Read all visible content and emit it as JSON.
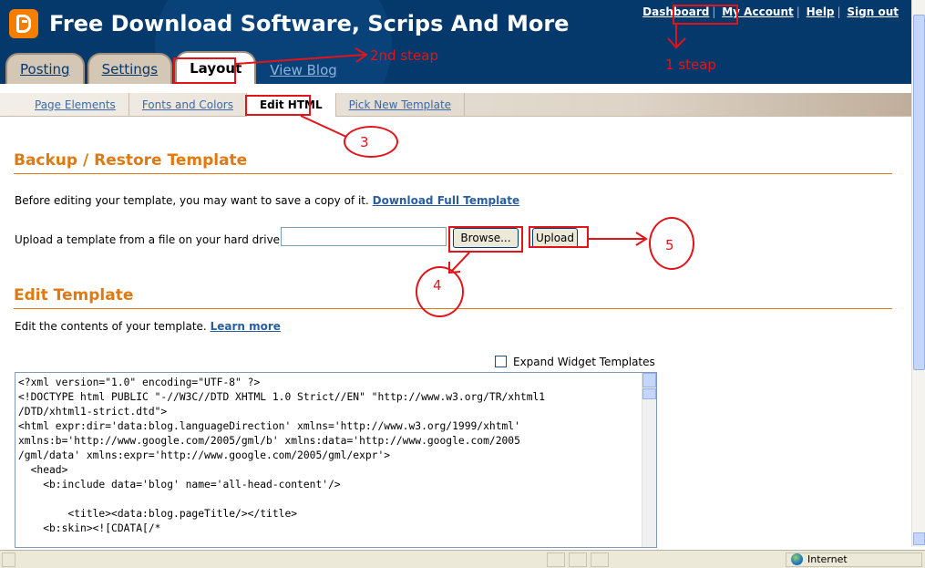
{
  "header": {
    "blog_title": "Free Download Software, Scrips And More",
    "account_links": [
      "Dashboard",
      "My Account",
      "Help",
      "Sign out"
    ]
  },
  "tabs": {
    "posting": "Posting",
    "settings": "Settings",
    "layout": "Layout",
    "view_blog": "View Blog"
  },
  "subnav": {
    "page_elements": "Page Elements",
    "fonts_colors": "Fonts and Colors",
    "edit_html": "Edit HTML",
    "pick_template": "Pick New Template"
  },
  "backup": {
    "title": "Backup / Restore Template",
    "intro": "Before editing your template, you may want to save a copy of it.",
    "download_link": "Download Full Template",
    "upload_label": "Upload a template from a file on your hard drive:",
    "file_value": "",
    "browse_label": "Browse...",
    "upload_button": "Upload"
  },
  "edit": {
    "title": "Edit Template",
    "intro": "Edit the contents of your template.",
    "learn_more": "Learn more",
    "expand_label": "Expand Widget Templates",
    "expand_checked": false,
    "code_lines": [
      "<?xml version=\"1.0\" encoding=\"UTF-8\" ?>",
      "<!DOCTYPE html PUBLIC \"-//W3C//DTD XHTML 1.0 Strict//EN\" \"http://www.w3.org/TR/xhtml1",
      "/DTD/xhtml1-strict.dtd\">",
      "<html expr:dir='data:blog.languageDirection' xmlns='http://www.w3.org/1999/xhtml'",
      "xmlns:b='http://www.google.com/2005/gml/b' xmlns:data='http://www.google.com/2005",
      "/gml/data' xmlns:expr='http://www.google.com/2005/gml/expr'>",
      "  <head>",
      "    <b:include data='blog' name='all-head-content'/>",
      "",
      "        <title><data:blog.pageTitle/></title>",
      "    <b:skin><![CDATA[/*"
    ]
  },
  "annotations": {
    "step1": "1 steap",
    "step2": "2nd steap",
    "step3": "3",
    "step4": "4",
    "step5": "5"
  },
  "status_bar": {
    "zone": "Internet"
  },
  "colors": {
    "header_bg": "#06396b",
    "accent_orange": "#e07a10",
    "link_blue": "#2a5da0",
    "annotation_red": "#e2141a"
  }
}
